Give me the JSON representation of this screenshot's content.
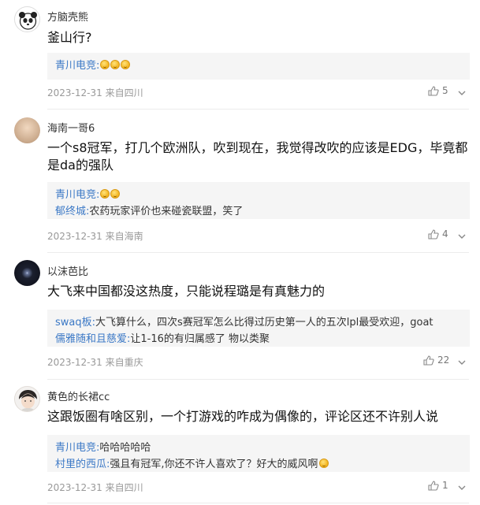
{
  "comments": [
    {
      "username": "方脑壳熊",
      "text": "釜山行?",
      "replies": [
        {
          "name": "青川电竞:",
          "text": "",
          "emojis": 3
        }
      ],
      "date": "2023-12-31",
      "location": "来自四川",
      "likes": "5",
      "avatar": "panda"
    },
    {
      "username": "海南一哥6",
      "text": "一个s8冠军，打几个欧洲队，吹到现在，我觉得改吹的应该是EDG，毕竟都是da的强队",
      "replies": [
        {
          "name": "青川电竞:",
          "text": "",
          "emojis": 2
        },
        {
          "name": "郁终城:",
          "text": "农药玩家评价也来碰瓷联盟，笑了",
          "emojis": 0
        }
      ],
      "date": "2023-12-31",
      "location": "来自海南",
      "likes": "4",
      "avatar": "photo"
    },
    {
      "username": "以沫芭比",
      "text": "大飞来中国都没这热度，只能说程璐是有真魅力的",
      "replies": [
        {
          "name": "swaq板:",
          "text": "大飞算什么，四次s赛冠军怎么比得过历史第一人的五次lpl最受欢迎，goat",
          "emojis": 0
        },
        {
          "name": "儒雅随和且慈爱:",
          "text": "让1-16的有归属感了 物以类聚",
          "emojis": 0
        }
      ],
      "date": "2023-12-31",
      "location": "来自重庆",
      "likes": "22",
      "avatar": "dark"
    },
    {
      "username": "黄色的长裙cc",
      "text": "这跟饭圈有啥区别，一个打游戏的咋成为偶像的，评论区还不许别人说",
      "replies": [
        {
          "name": "青川电竞:",
          "text": "哈哈哈哈哈",
          "emojis": 0
        },
        {
          "name": "村里的西瓜:",
          "text": "强且有冠军,你还不许人喜欢了？好大的威风啊",
          "emojis": 1
        }
      ],
      "date": "2023-12-31",
      "location": "来自四川",
      "likes": "1",
      "avatar": "boy"
    }
  ]
}
